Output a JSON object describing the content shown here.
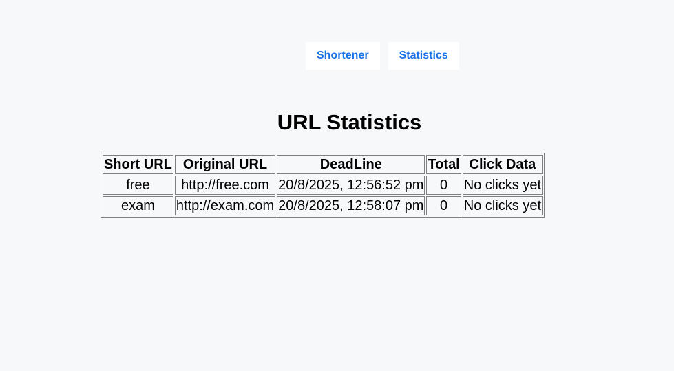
{
  "nav": {
    "shortener_label": "Shortener",
    "statistics_label": "Statistics"
  },
  "page": {
    "title": "URL Statistics"
  },
  "table": {
    "headers": [
      "Short URL",
      "Original URL",
      "DeadLine",
      "Total",
      "Click Data"
    ],
    "rows": [
      {
        "short": "free",
        "original": "http://free.com",
        "deadline": "20/8/2025, 12:56:52 pm",
        "total": "0",
        "clicks": "No clicks yet"
      },
      {
        "short": "exam",
        "original": "http://exam.com",
        "deadline": "20/8/2025, 12:58:07 pm",
        "total": "0",
        "clicks": "No clicks yet"
      }
    ]
  },
  "colors": {
    "background": "#f7f8fa",
    "nav_text": "#1a73e8"
  }
}
